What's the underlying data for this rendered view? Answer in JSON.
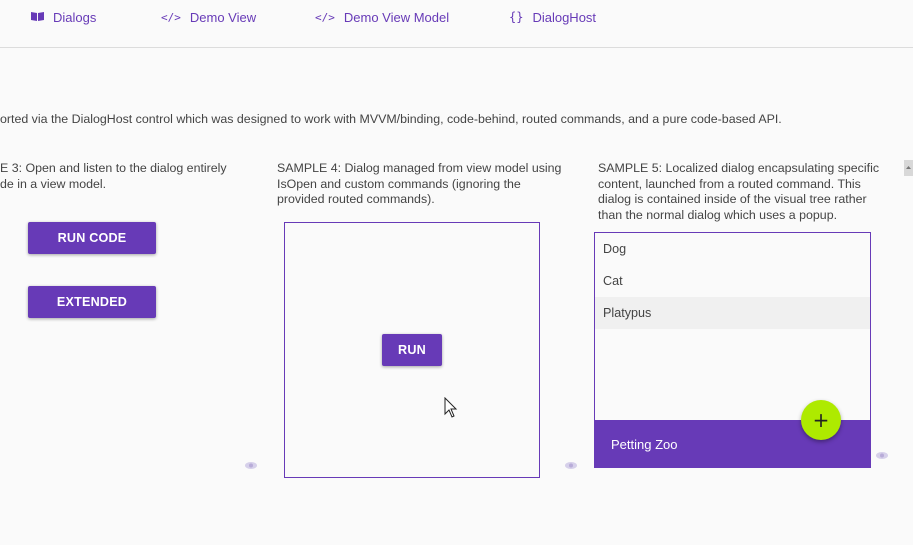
{
  "nav": {
    "tabs": [
      {
        "label": "Dialogs",
        "icon": "book-icon"
      },
      {
        "label": "Demo View",
        "icon": "code-icon"
      },
      {
        "label": "Demo View Model",
        "icon": "code-icon"
      },
      {
        "label": "DialogHost",
        "icon": "braces-icon"
      }
    ]
  },
  "intro": {
    "text": "orted via the DialogHost control which was designed to work with MVVM/binding, code-behind, routed commands, and a pure code-based API."
  },
  "sample3": {
    "line1": "E 3: Open and listen to the dialog entirely",
    "line2": "de in a view model.",
    "run_code_label": "RUN CODE",
    "extended_label": "EXTENDED"
  },
  "sample4": {
    "line1": "SAMPLE 4: Dialog managed from view model using",
    "line2": "IsOpen and custom commands (ignoring the",
    "line3": "provided routed commands).",
    "run_label": "RUN"
  },
  "sample5": {
    "line1": "SAMPLE 5: Localized dialog encapsulating specific",
    "line2": "content, launched from a routed command. This",
    "line3": "dialog is contained inside of the visual tree rather",
    "line4": "than the normal dialog which uses a popup.",
    "items": [
      "Dog",
      "Cat",
      "Platypus"
    ],
    "footer_label": "Petting Zoo",
    "fab_label": "+"
  },
  "colors": {
    "primary": "#673ab7",
    "accent": "#aeea00",
    "background": "#fafafa",
    "selected_row": "#f0f0f0"
  }
}
